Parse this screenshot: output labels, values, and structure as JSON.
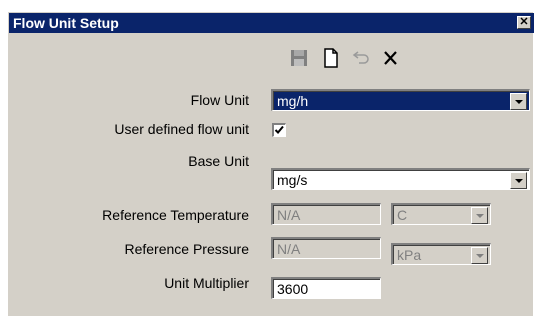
{
  "window": {
    "title": "Flow Unit Setup",
    "close_glyph": "✕"
  },
  "toolbar": {
    "buttons": [
      {
        "name": "save-icon",
        "enabled": false
      },
      {
        "name": "new-document-icon",
        "enabled": true
      },
      {
        "name": "undo-icon",
        "enabled": false
      },
      {
        "name": "delete-icon",
        "enabled": true
      }
    ]
  },
  "form": {
    "flow_unit_label": "Flow Unit",
    "flow_unit_value": "mg/h",
    "user_defined_label": "User defined flow unit",
    "user_defined_checked": true,
    "base_unit_label": "Base Unit",
    "base_unit_value": "mg/s",
    "ref_temp_label": "Reference Temperature",
    "ref_temp_value": "N/A",
    "ref_temp_unit": "C",
    "ref_pressure_label": "Reference Pressure",
    "ref_pressure_value": "N/A",
    "ref_pressure_unit": "kPa",
    "multiplier_label": "Unit Multiplier",
    "multiplier_value": "3600"
  },
  "colors": {
    "titlebar": "#0a246a",
    "dialog_bg": "#d4d0c8",
    "selection": "#0a246a"
  }
}
